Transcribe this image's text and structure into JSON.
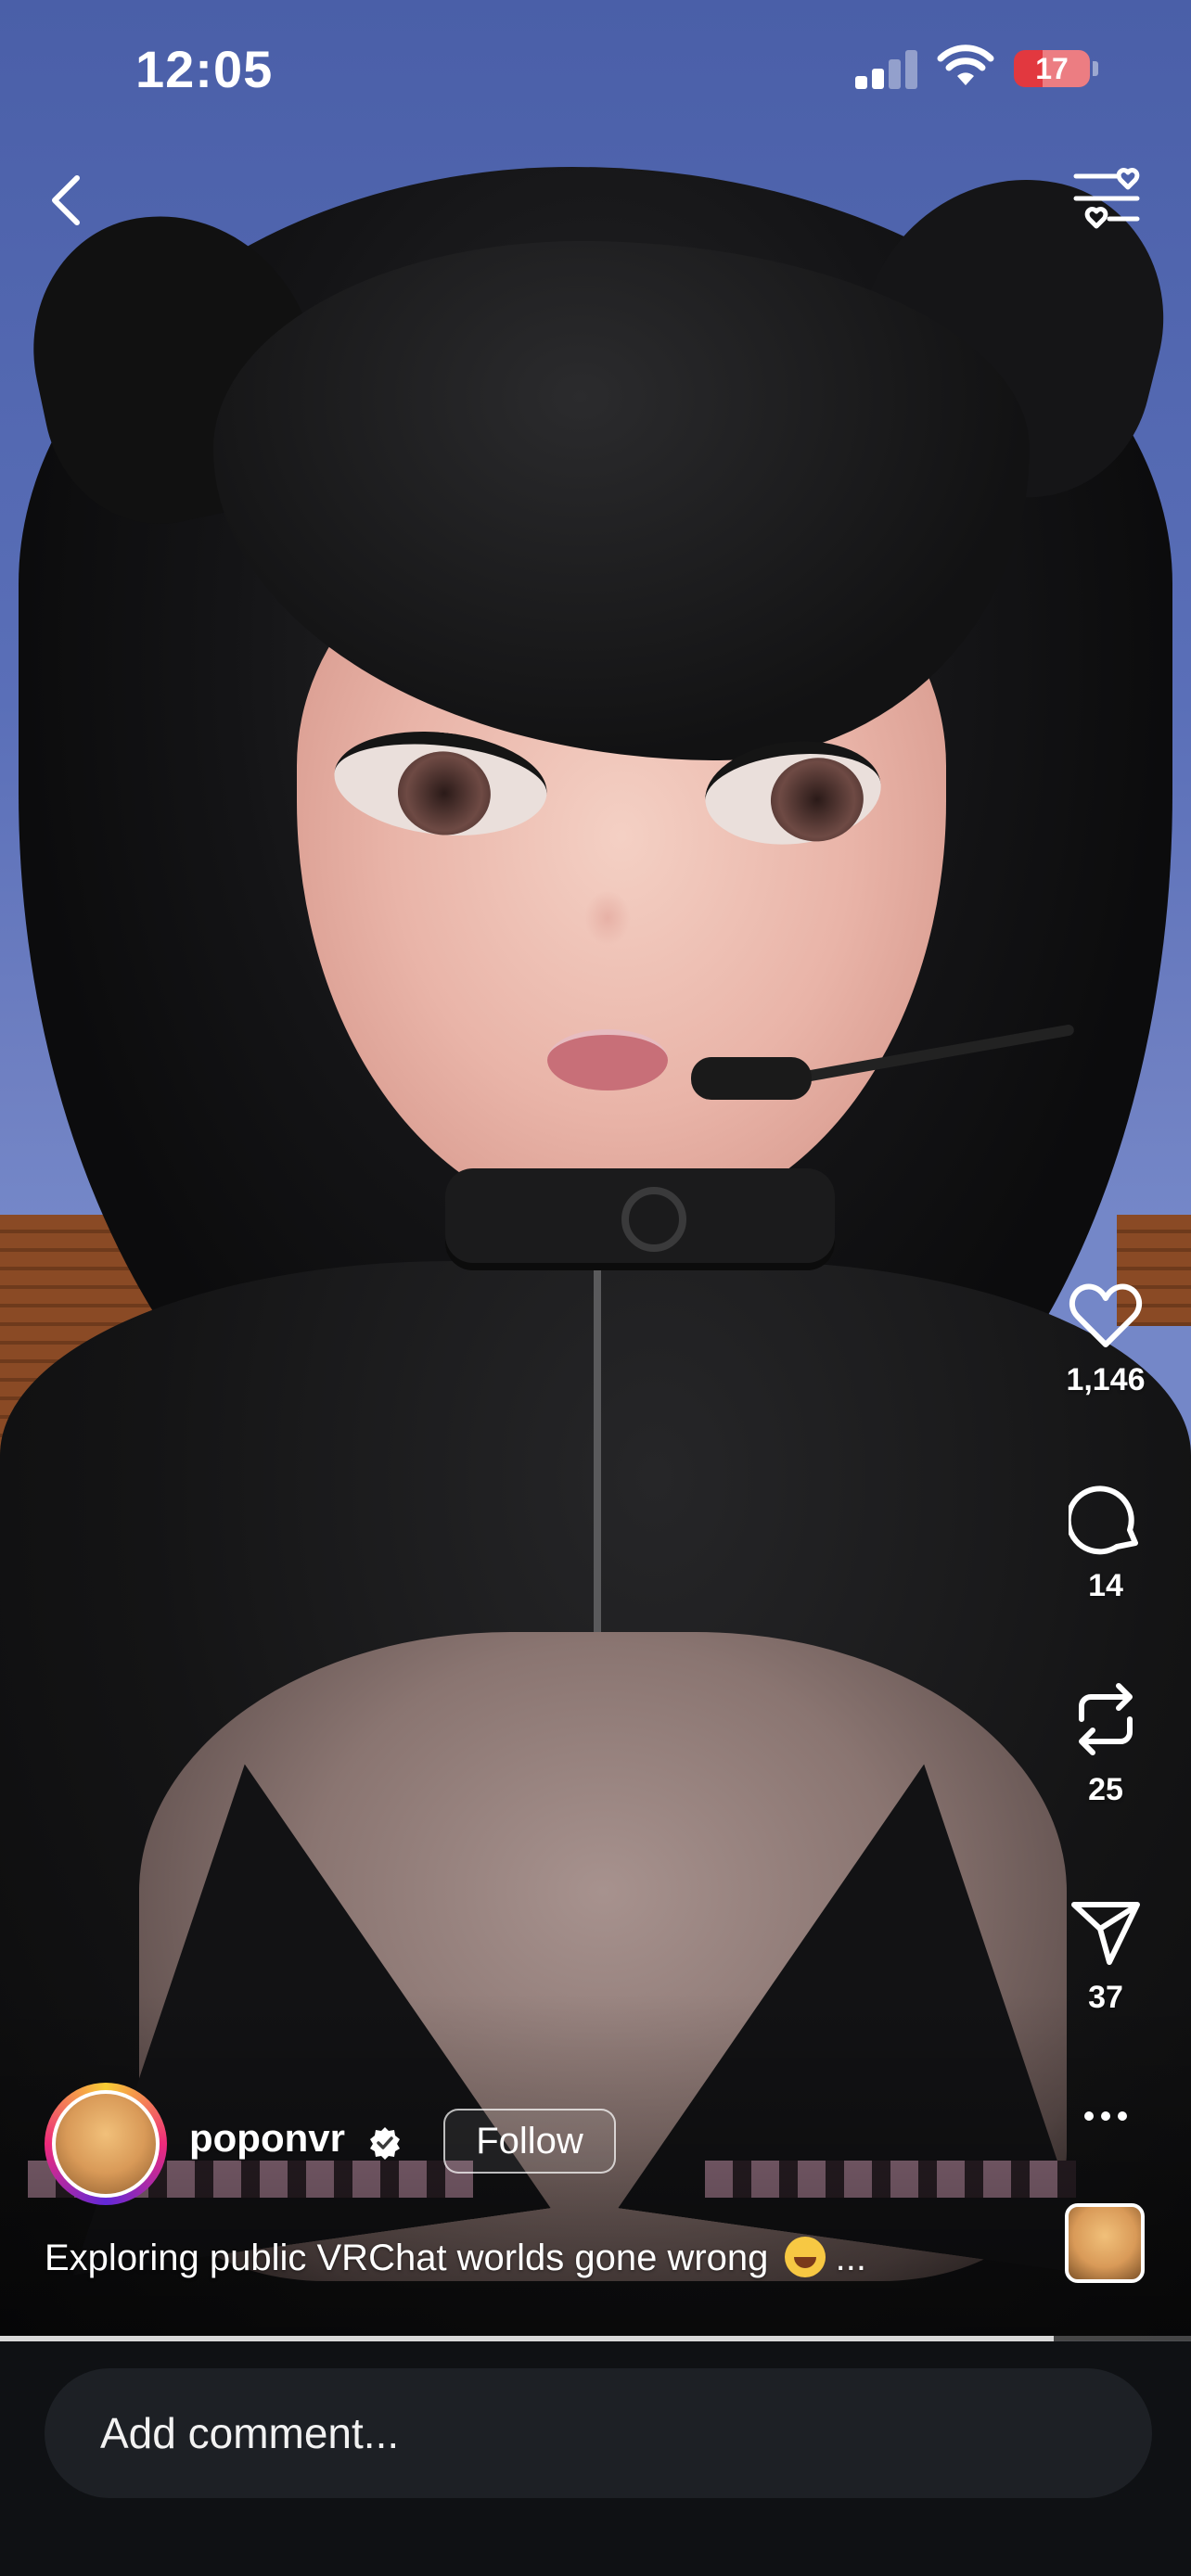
{
  "status_bar": {
    "time": "12:05",
    "battery_level": "17",
    "battery_color": "#e2383f"
  },
  "header": {
    "back_icon": "chevron-left-icon",
    "filter_icon": "heart-sliders-icon"
  },
  "actions": {
    "like": {
      "icon": "heart-icon",
      "count": "1,146"
    },
    "comment": {
      "icon": "comment-bubble-icon",
      "count": "14"
    },
    "repost": {
      "icon": "repost-icon",
      "count": "25"
    },
    "share": {
      "icon": "paper-plane-icon",
      "count": "37"
    },
    "more": {
      "icon": "more-horizontal-icon"
    }
  },
  "post": {
    "username": "poponvr",
    "verified": true,
    "follow_label": "Follow",
    "caption": "Exploring public VRChat worlds gone wrong",
    "caption_emoji": "laughing-tears-emoji",
    "caption_ellipsis": " ..."
  },
  "playback": {
    "progress": 0.885
  },
  "comment_bar": {
    "placeholder": "Add comment..."
  }
}
